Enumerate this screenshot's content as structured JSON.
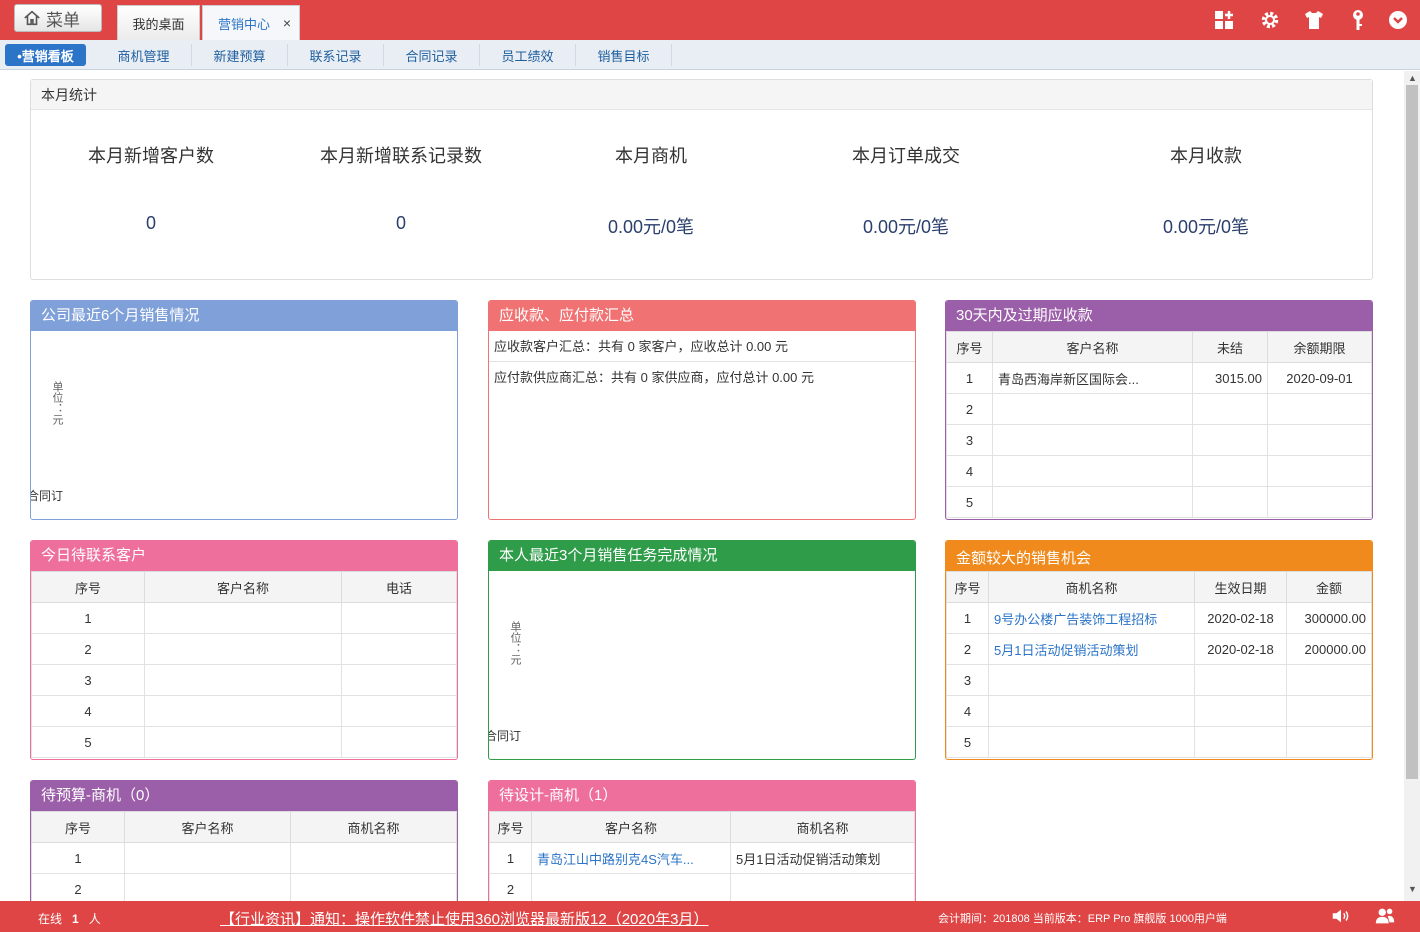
{
  "header": {
    "menu_label": "菜单",
    "tabs": [
      {
        "label": "我的桌面"
      },
      {
        "label": "营销中心",
        "close": "×"
      }
    ],
    "icons": [
      "apps-icon",
      "gear-icon",
      "shirt-icon",
      "key-icon",
      "chevron-down-circle-icon"
    ]
  },
  "subnav": {
    "items": [
      {
        "label": "•营销看板",
        "active": true
      },
      {
        "label": "商机管理"
      },
      {
        "label": "新建预算"
      },
      {
        "label": "联系记录"
      },
      {
        "label": "合同记录"
      },
      {
        "label": "员工绩效"
      },
      {
        "label": "销售目标"
      }
    ]
  },
  "stats": {
    "title": "本月统计",
    "items": [
      {
        "label": "本月新增客户数",
        "value": "0"
      },
      {
        "label": "本月新增联系记录数",
        "value": "0"
      },
      {
        "label": "本月商机",
        "value": "0.00元/0笔"
      },
      {
        "label": "本月订单成交",
        "value": "0.00元/0笔"
      },
      {
        "label": "本月收款",
        "value": "0.00元/0笔"
      }
    ]
  },
  "panels": {
    "sales6": {
      "title": "公司最近6个月销售情况",
      "unit": "单位：元",
      "ylabel": "合同订",
      "color": "#7fa0d8"
    },
    "ar_ap": {
      "title": "应收款、应付款汇总",
      "lines": [
        "应收款客户汇总：共有 0 家客户，应收总计 0.00 元",
        "应付款供应商汇总：共有 0 家供应商，应付总计 0.00 元"
      ],
      "color": "#f07272"
    },
    "receivables30": {
      "title": "30天内及过期应收款",
      "headers": [
        "序号",
        "客户名称",
        "未结",
        "余额期限"
      ],
      "rows": [
        [
          "1",
          "青岛西海岸新区国际会...",
          "3015.00",
          "2020-09-01"
        ],
        [
          "2",
          "",
          "",
          ""
        ],
        [
          "3",
          "",
          "",
          ""
        ],
        [
          "4",
          "",
          "",
          ""
        ],
        [
          "5",
          "",
          "",
          ""
        ]
      ],
      "color": "#9b5ea8"
    },
    "today_contact": {
      "title": "今日待联系客户",
      "headers": [
        "序号",
        "客户名称",
        "电话"
      ],
      "rows": [
        [
          "1",
          "",
          ""
        ],
        [
          "2",
          "",
          ""
        ],
        [
          "3",
          "",
          ""
        ],
        [
          "4",
          "",
          ""
        ],
        [
          "5",
          "",
          ""
        ]
      ],
      "color": "#ee6f9c"
    },
    "my3": {
      "title": "本人最近3个月销售任务完成情况",
      "unit": "单位：元",
      "ylabel": "合同订",
      "color": "#2f9c4a"
    },
    "big_opps": {
      "title": "金额较大的销售机会",
      "headers": [
        "序号",
        "商机名称",
        "生效日期",
        "金额"
      ],
      "rows": [
        [
          "1",
          "9号办公楼广告装饰工程招标",
          "2020-02-18",
          "300000.00"
        ],
        [
          "2",
          "5月1日活动促销活动策划",
          "2020-02-18",
          "200000.00"
        ],
        [
          "3",
          "",
          "",
          ""
        ],
        [
          "4",
          "",
          "",
          ""
        ],
        [
          "5",
          "",
          "",
          ""
        ]
      ],
      "color": "#f08a1c"
    },
    "pending_budget": {
      "title": "待预算-商机（0）",
      "headers": [
        "序号",
        "客户名称",
        "商机名称"
      ],
      "rows": [
        [
          "1",
          "",
          ""
        ],
        [
          "2",
          "",
          ""
        ]
      ],
      "color": "#9b5ea8"
    },
    "pending_design": {
      "title": "待设计-商机（1）",
      "headers": [
        "序号",
        "客户名称",
        "商机名称"
      ],
      "rows": [
        [
          "1",
          "青岛江山中路别克4S汽车...",
          "5月1日活动促销活动策划"
        ],
        [
          "2",
          "",
          ""
        ]
      ],
      "color": "#ee6f9c"
    }
  },
  "footer": {
    "online_prefix": "在线",
    "online_count": "1",
    "online_suffix": "人",
    "notice": "【行业资讯】通知：操作软件禁止使用360浏览器最新版12（2020年3月）",
    "period": "会计期间：201808 当前版本：ERP Pro 旗舰版 1000用户端",
    "icons": [
      "speaker-icon",
      "users-icon"
    ]
  }
}
